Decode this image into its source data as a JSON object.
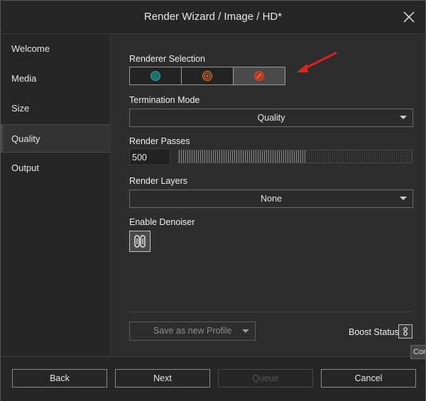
{
  "window": {
    "title": "Render Wizard / Image / HD*"
  },
  "sidebar": {
    "items": [
      {
        "label": "Welcome",
        "active": false
      },
      {
        "label": "Media",
        "active": false
      },
      {
        "label": "Size",
        "active": false
      },
      {
        "label": "Quality",
        "active": true
      },
      {
        "label": "Output",
        "active": false
      }
    ]
  },
  "renderer": {
    "label": "Renderer Selection",
    "options": [
      {
        "icon": "circle-icon",
        "color": "#1f8f86",
        "active": false
      },
      {
        "icon": "concentric-circles-icon",
        "color": "#e06c1c",
        "active": false
      },
      {
        "icon": "slashed-circle-icon",
        "color": "#d9482b",
        "active": true
      }
    ]
  },
  "termination": {
    "label": "Termination Mode",
    "value": "Quality"
  },
  "passes": {
    "label": "Render Passes",
    "value": "500",
    "fraction": 0.55
  },
  "layers": {
    "label": "Render Layers",
    "value": "None"
  },
  "denoiser": {
    "label": "Enable Denoiser",
    "icon": "denoiser-icon"
  },
  "profile": {
    "label": "Save as new Profile"
  },
  "boost": {
    "label": "Boost Status",
    "icon": "boost-icon"
  },
  "tooltip": {
    "text": "Cor"
  },
  "footer": {
    "back": "Back",
    "next": "Next",
    "queue": "Queue",
    "cancel": "Cancel"
  },
  "annotation": {
    "arrow_color": "#e02020"
  }
}
